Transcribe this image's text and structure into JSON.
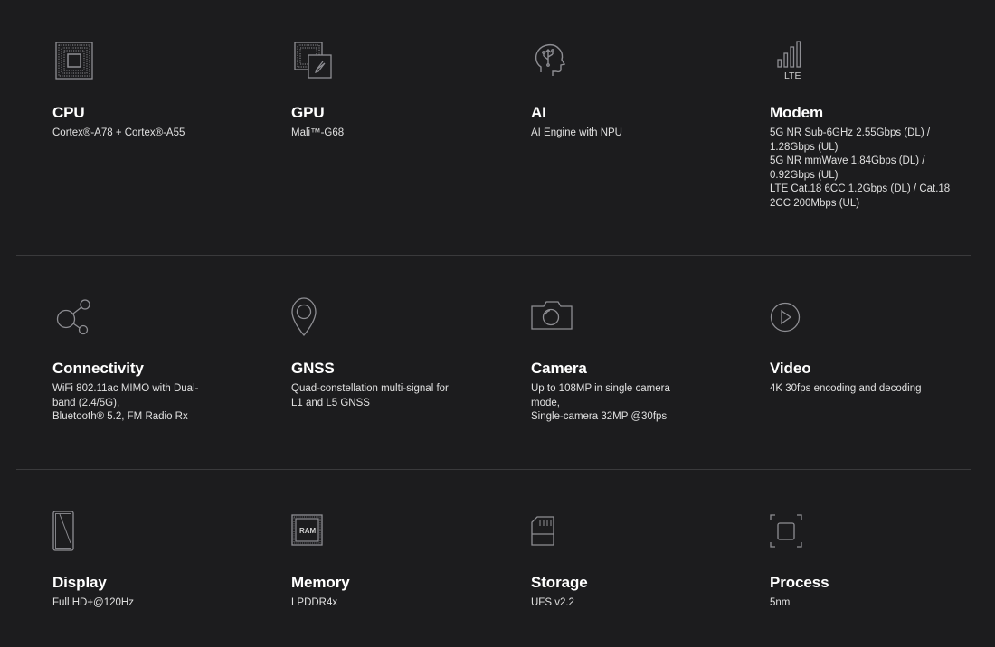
{
  "specs": [
    {
      "icon": "cpu-chip-icon",
      "title": "CPU",
      "lines": [
        "Cortex®-A78 + Cortex®-A55"
      ]
    },
    {
      "icon": "gpu-chip-icon",
      "title": "GPU",
      "lines": [
        "Mali™-G68"
      ]
    },
    {
      "icon": "ai-head-icon",
      "title": "AI",
      "lines": [
        "AI Engine with NPU"
      ]
    },
    {
      "icon": "lte-signal-icon",
      "icon_text": "LTE",
      "title": "Modem",
      "lines": [
        "5G NR Sub-6GHz 2.55Gbps (DL) /",
        "1.28Gbps (UL)",
        "5G NR mmWave 1.84Gbps (DL) /",
        "0.92Gbps (UL)",
        "LTE Cat.18 6CC 1.2Gbps (DL) / Cat.18",
        "2CC 200Mbps (UL)"
      ]
    },
    {
      "icon": "share-nodes-icon",
      "title": "Connectivity",
      "lines": [
        "WiFi 802.11ac MIMO with Dual-",
        "band (2.4/5G),",
        "Bluetooth® 5.2, FM Radio Rx"
      ]
    },
    {
      "icon": "location-pin-icon",
      "title": "GNSS",
      "lines": [
        "Quad-constellation multi-signal for",
        "L1 and L5 GNSS"
      ]
    },
    {
      "icon": "camera-icon",
      "title": "Camera",
      "lines": [
        "Up to 108MP in single camera",
        "mode,",
        "Single-camera 32MP @30fps"
      ]
    },
    {
      "icon": "play-circle-icon",
      "title": "Video",
      "lines": [
        "4K 30fps encoding and decoding"
      ]
    },
    {
      "icon": "phone-display-icon",
      "title": "Display",
      "lines": [
        "Full HD+@120Hz"
      ]
    },
    {
      "icon": "ram-chip-icon",
      "icon_text": "RAM",
      "title": "Memory",
      "lines": [
        "LPDDR4x"
      ]
    },
    {
      "icon": "sd-card-icon",
      "title": "Storage",
      "lines": [
        "UFS v2.2"
      ]
    },
    {
      "icon": "process-square-icon",
      "title": "Process",
      "lines": [
        "5nm"
      ]
    }
  ]
}
